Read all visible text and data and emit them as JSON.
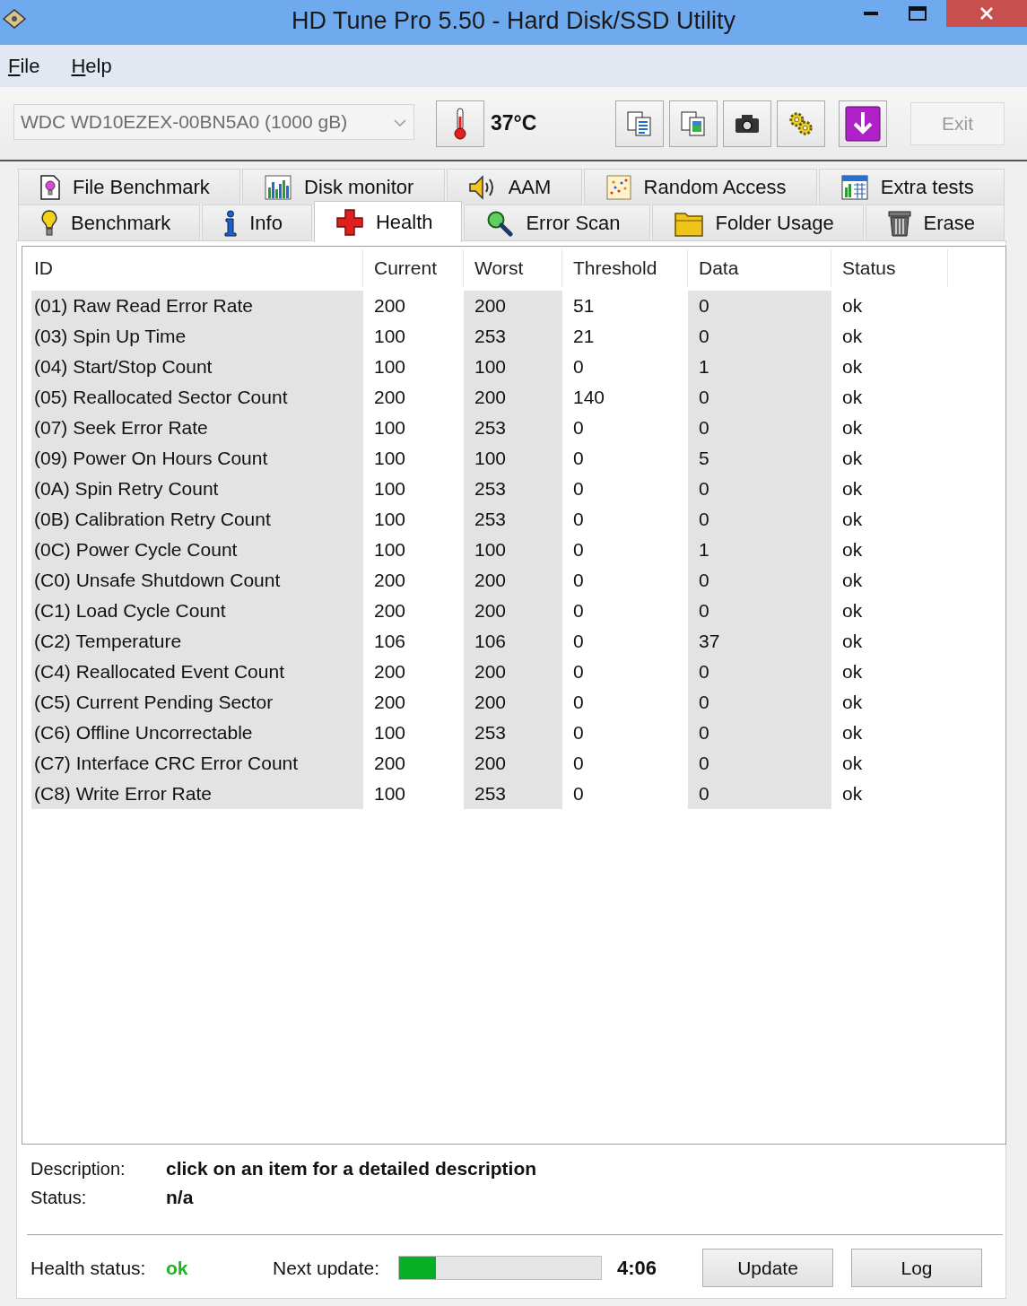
{
  "window": {
    "title": "HD Tune Pro 5.50 - Hard Disk/SSD Utility"
  },
  "menu": [
    {
      "label": "File"
    },
    {
      "label": "Help"
    }
  ],
  "toolbar": {
    "drive_select": {
      "value": "WDC WD10EZEX-00BN5A0 (1000 gB)",
      "disabled": true
    },
    "temperature": "37°C",
    "exit_button": {
      "label": "Exit",
      "disabled": true
    }
  },
  "tab_rows": [
    {
      "tabs": [
        {
          "label": "File Benchmark",
          "selected": false
        },
        {
          "label": "Disk monitor",
          "selected": false
        },
        {
          "label": "AAM",
          "selected": false
        },
        {
          "label": "Random Access",
          "selected": false
        },
        {
          "label": "Extra tests",
          "selected": false
        }
      ]
    },
    {
      "tabs": [
        {
          "label": "Benchmark",
          "selected": false
        },
        {
          "label": "Info",
          "selected": false
        },
        {
          "label": "Health",
          "selected": true
        },
        {
          "label": "Error Scan",
          "selected": false
        },
        {
          "label": "Folder Usage",
          "selected": false
        },
        {
          "label": "Erase",
          "selected": false
        }
      ]
    }
  ],
  "table": {
    "columns": [
      "ID",
      "Current",
      "Worst",
      "Threshold",
      "Data",
      "Status"
    ],
    "rows": [
      [
        "(01) Raw Read Error Rate",
        "200",
        "200",
        "51",
        "0",
        "ok"
      ],
      [
        "(03) Spin Up Time",
        "100",
        "253",
        "21",
        "0",
        "ok"
      ],
      [
        "(04) Start/Stop Count",
        "100",
        "100",
        "0",
        "1",
        "ok"
      ],
      [
        "(05) Reallocated Sector Count",
        "200",
        "200",
        "140",
        "0",
        "ok"
      ],
      [
        "(07) Seek Error Rate",
        "100",
        "253",
        "0",
        "0",
        "ok"
      ],
      [
        "(09) Power On Hours Count",
        "100",
        "100",
        "0",
        "5",
        "ok"
      ],
      [
        "(0A) Spin Retry Count",
        "100",
        "253",
        "0",
        "0",
        "ok"
      ],
      [
        "(0B) Calibration Retry Count",
        "100",
        "253",
        "0",
        "0",
        "ok"
      ],
      [
        "(0C) Power Cycle Count",
        "100",
        "100",
        "0",
        "1",
        "ok"
      ],
      [
        "(C0) Unsafe Shutdown Count",
        "200",
        "200",
        "0",
        "0",
        "ok"
      ],
      [
        "(C1) Load Cycle Count",
        "200",
        "200",
        "0",
        "0",
        "ok"
      ],
      [
        "(C2) Temperature",
        "106",
        "106",
        "0",
        "37",
        "ok"
      ],
      [
        "(C4) Reallocated Event Count",
        "200",
        "200",
        "0",
        "0",
        "ok"
      ],
      [
        "(C5) Current Pending Sector",
        "200",
        "200",
        "0",
        "0",
        "ok"
      ],
      [
        "(C6) Offline Uncorrectable",
        "100",
        "253",
        "0",
        "0",
        "ok"
      ],
      [
        "(C7) Interface CRC Error Count",
        "200",
        "200",
        "0",
        "0",
        "ok"
      ],
      [
        "(C8) Write Error Rate",
        "100",
        "253",
        "0",
        "0",
        "ok"
      ]
    ]
  },
  "details": {
    "description_label": "Description:",
    "description": "click on an item for a detailed description",
    "status_label": "Status:",
    "status": "n/a"
  },
  "footer": {
    "health_label": "Health status:",
    "health": "ok",
    "next_update_label": "Next update:",
    "progress": {
      "level": 0.18
    },
    "countdown": "4:06",
    "buttons": [
      "Update",
      "Log"
    ]
  }
}
